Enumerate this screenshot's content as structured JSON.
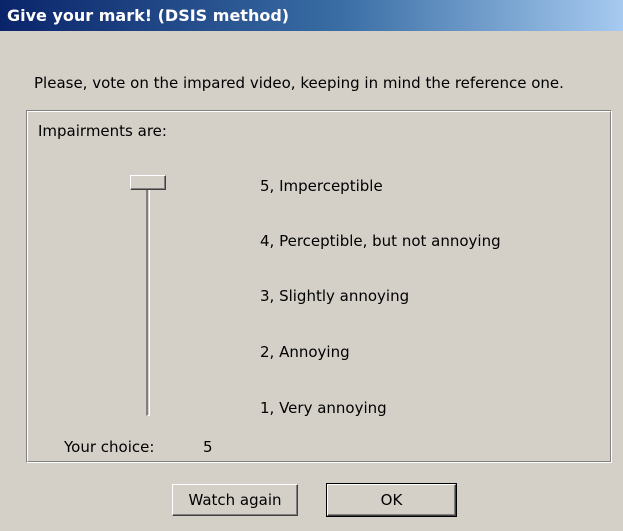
{
  "window": {
    "title": "Give your mark! (DSIS method)",
    "instruction": "Please, vote on the impared video, keeping in mind the reference one."
  },
  "group": {
    "label": "Impairments are:",
    "scale": [
      {
        "score": 5,
        "text": "5, Imperceptible"
      },
      {
        "score": 4,
        "text": "4, Perceptible, but not annoying"
      },
      {
        "score": 3,
        "text": "3, Slightly annoying"
      },
      {
        "score": 2,
        "text": "2, Annoying"
      },
      {
        "score": 1,
        "text": "1, Very annoying"
      }
    ],
    "slider": {
      "min": 1,
      "max": 5,
      "value": 5
    },
    "choice_label": "Your choice:",
    "choice_value": "5"
  },
  "buttons": {
    "watch_again": "Watch again",
    "ok": "OK"
  },
  "colors": {
    "dialog_bg": "#d4d0c8",
    "titlebar_start": "#0a246a",
    "titlebar_end": "#a6caf0",
    "title_text": "#ffffff"
  }
}
